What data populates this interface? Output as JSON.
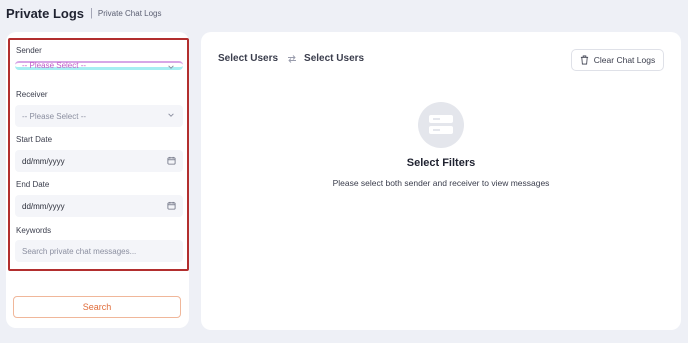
{
  "header": {
    "title": "Private Logs",
    "separator": "|",
    "breadcrumb": "Private Chat Logs"
  },
  "filters": {
    "sender": {
      "label": "Sender",
      "placeholder": "-- Please Select --"
    },
    "receiver": {
      "label": "Receiver",
      "placeholder": "-- Please Select --"
    },
    "start_date": {
      "label": "Start Date",
      "value": "dd/mm/yyyy"
    },
    "end_date": {
      "label": "End Date",
      "value": "dd/mm/yyyy"
    },
    "keywords": {
      "label": "Keywords",
      "placeholder": "Search private chat messages..."
    },
    "search_label": "Search"
  },
  "main": {
    "sender_title": "Select Users",
    "receiver_title": "Select Users",
    "clear_label": "Clear Chat Logs",
    "empty_title": "Select Filters",
    "empty_desc": "Please select both sender and receiver to view messages"
  },
  "colors": {
    "accent": "#e06d3b",
    "highlight_border": "#b22e2e",
    "background": "#eef0f6"
  },
  "icons": [
    "swap-icon",
    "trash-icon",
    "filter-placeholder-icon",
    "chevron-down-icon",
    "calendar-icon"
  ]
}
